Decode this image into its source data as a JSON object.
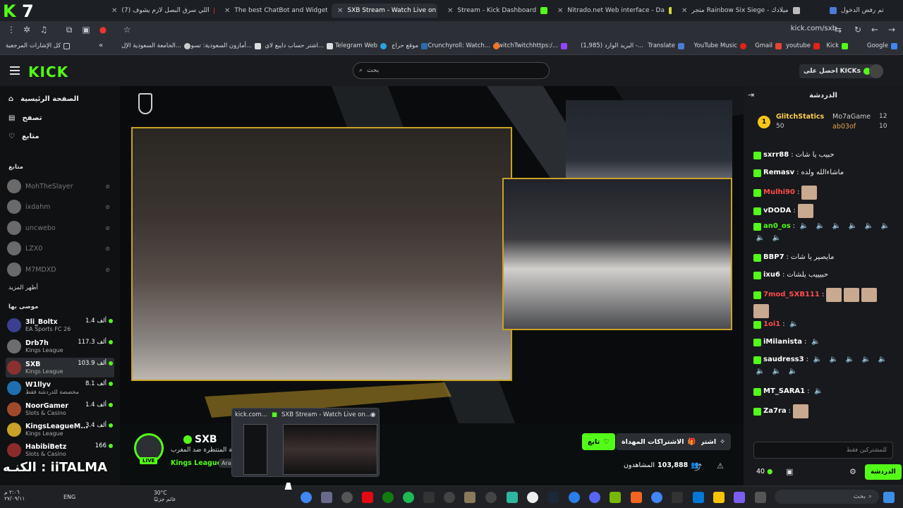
{
  "tabs": [
    {
      "label": "تم رفض الدخول",
      "active": false
    },
    {
      "label": "متجر Rainbow Six Siege - ميلادك",
      "active": false
    },
    {
      "label": "Nitrado.net Web interface - Da",
      "active": false
    },
    {
      "label": "Stream - Kick Dashboard",
      "active": false
    },
    {
      "label": "SXB Stream - Watch Live on",
      "active": true
    },
    {
      "label": "The best ChatBot and Widget",
      "active": false
    },
    {
      "label": "(7) اللي سرق البصل لازم يشوف",
      "active": false
    }
  ],
  "address": {
    "url": "kick.com/sxb"
  },
  "bookmarks": [
    "Google",
    "Kick",
    "youtube",
    "Gmail",
    "YouTube Music",
    "Translate",
    "(1,985) البريد الوارد -...",
    "TwitchTwitchhttps:/...",
    "Crunchyroll: Watch...",
    "موقع حراج",
    "Telegram Web",
    "اشتر حساب دايبع لاي...",
    "أمازون السعودية: تسو...",
    "الجامعة السعودية الإل...",
    "كل الإشارات المرجعية"
  ],
  "header": {
    "logo": "KICK",
    "search_placeholder": "بحث",
    "get_kicks": "احصل على KICKs"
  },
  "sidebar": {
    "nav": [
      {
        "label": "الصفحة الرئيسية"
      },
      {
        "label": "تصفح"
      },
      {
        "label": "متابع"
      }
    ],
    "following_title": "متابع",
    "following": [
      {
        "name": "MohTheSlayer"
      },
      {
        "name": "ixdahm"
      },
      {
        "name": "uncwebo"
      },
      {
        "name": "LZX0"
      },
      {
        "name": "M7MDXD"
      }
    ],
    "show_more": "أظهر المزيد",
    "recommended_title": "موصى بها",
    "recommended": [
      {
        "name": "3li_Boltx",
        "category": "EA Sports FC 26",
        "viewers": "1.4 ألف",
        "color": "#3a3f8f"
      },
      {
        "name": "Drb7h",
        "category": "Kings League",
        "viewers": "117.3 ألف",
        "color": "#6d6d6d"
      },
      {
        "name": "SXB",
        "category": "Kings League",
        "viewers": "103.9 ألف",
        "color": "#8a3030"
      },
      {
        "name": "W1llyv",
        "category": "مخصصة للدردشة فقط",
        "viewers": "8.1 ألف",
        "color": "#1f6fb0"
      },
      {
        "name": "NoorGamer",
        "category": "Slots & Casino",
        "viewers": "1.4 ألف",
        "color": "#a04a2c"
      },
      {
        "name": "KingsLeagueM...",
        "category": "Kings League",
        "viewers": "3.4 ألف",
        "color": "#c9a227"
      },
      {
        "name": "HabibiBetz",
        "category": "Slots & Casino",
        "viewers": "166",
        "color": "#8c2b2b"
      }
    ]
  },
  "stream": {
    "channel": "SXB",
    "title": "بطولة المنتظرة ضد المغرب",
    "category": "Kings League",
    "tag": "Arab",
    "live_label": "LIVE",
    "viewers_label": "المشاهدون",
    "viewers": "103,888",
    "share": "اشترك",
    "subs": "الاشتراكات المهداة",
    "follow": "تابع"
  },
  "popup": {
    "title1": "kick.com...",
    "title2": "SXB Stream - Watch Live on..."
  },
  "chat": {
    "title": "الدردشة",
    "pinned": {
      "left_user": "GlitchStatics",
      "left_count": "50",
      "right1_user": "Mo7aGame",
      "right1_count": "12",
      "right2_user": "ab03of",
      "right2_count": "10"
    },
    "messages": [
      {
        "user": "sxrr88",
        "text": "حبيب يا شات",
        "color": "#ffffff",
        "emotes": 0,
        "speakers": 0
      },
      {
        "user": "Remasv",
        "text": "ماشاءالله ولده",
        "color": "#ffffff",
        "emotes": 0,
        "speakers": 0
      },
      {
        "user": "Mulhi90",
        "text": "",
        "color": "#ff4d4d",
        "emotes": 1,
        "speakers": 0
      },
      {
        "user": "vDODA",
        "text": "",
        "color": "#ffffff",
        "emotes": 1,
        "speakers": 0
      },
      {
        "user": "an0_os",
        "text": "",
        "color": "#53fc18",
        "emotes": 0,
        "speakers": 8
      },
      {
        "user": "BBP7",
        "text": "مايصير يا شات",
        "color": "#ffffff",
        "emotes": 0,
        "speakers": 0
      },
      {
        "user": "ixu6",
        "text": "حبيييب يلشات",
        "color": "#ffffff",
        "emotes": 0,
        "speakers": 0
      },
      {
        "user": "7mod_SXB111",
        "text": "",
        "color": "#ff4d4d",
        "emotes": 4,
        "speakers": 0
      },
      {
        "user": "1oi1",
        "text": "",
        "color": "#ff4d4d",
        "emotes": 0,
        "speakers": 1
      },
      {
        "user": "iMilanista",
        "text": "",
        "color": "#ffffff",
        "emotes": 0,
        "speakers": 1
      },
      {
        "user": "saudress3",
        "text": "",
        "color": "#ffffff",
        "emotes": 0,
        "speakers": 8
      },
      {
        "user": "MT_SARA1",
        "text": "",
        "color": "#ffffff",
        "emotes": 0,
        "speakers": 1
      },
      {
        "user": "Za7ra",
        "text": "",
        "color": "#ffffff",
        "emotes": 1,
        "speakers": 0
      }
    ],
    "input_placeholder": "للمشتركين فقط",
    "points": "40",
    "send": "الدردشة"
  },
  "taskbar": {
    "search": "بحث",
    "lang": "ENG",
    "time": "٢:٠٦ م",
    "date": "٢٧/٠٩/١١",
    "temp": "30°C",
    "weather": "غائم جزئيًا"
  },
  "overlay": {
    "text": "الكنـه : iiTALMA"
  },
  "colors": {
    "kick_green": "#53fc18",
    "frame_gold": "#c9a227"
  }
}
